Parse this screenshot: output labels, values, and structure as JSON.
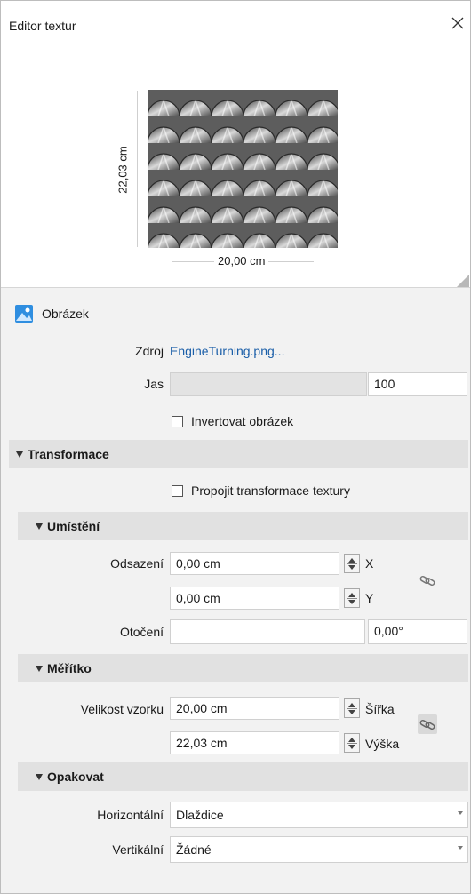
{
  "window": {
    "title": "Editor textur"
  },
  "preview": {
    "height_dim": "22,03 cm",
    "width_dim": "20,00 cm"
  },
  "image": {
    "header": "Obrázek",
    "source_label": "Zdroj",
    "source_value": "EngineTurning.png...",
    "brightness_label": "Jas",
    "brightness_value": "100",
    "invert_label": "Invertovat obrázek"
  },
  "transform": {
    "header": "Transformace",
    "link_label": "Propojit transformace textury",
    "placement": {
      "header": "Umístění",
      "offset_label": "Odsazení",
      "offset_x": "0,00 cm",
      "offset_y": "0,00 cm",
      "x_label": "X",
      "y_label": "Y",
      "rotation_label": "Otočení",
      "rotation_value": "0,00°"
    },
    "scale": {
      "header": "Měřítko",
      "size_label": "Velikost vzorku",
      "width_value": "20,00 cm",
      "height_value": "22,03 cm",
      "width_label": "Šířka",
      "height_label": "Výška"
    },
    "repeat": {
      "header": "Opakovat",
      "horizontal_label": "Horizontální",
      "horizontal_value": "Dlaždice",
      "vertical_label": "Vertikální",
      "vertical_value": "Žádné"
    }
  }
}
